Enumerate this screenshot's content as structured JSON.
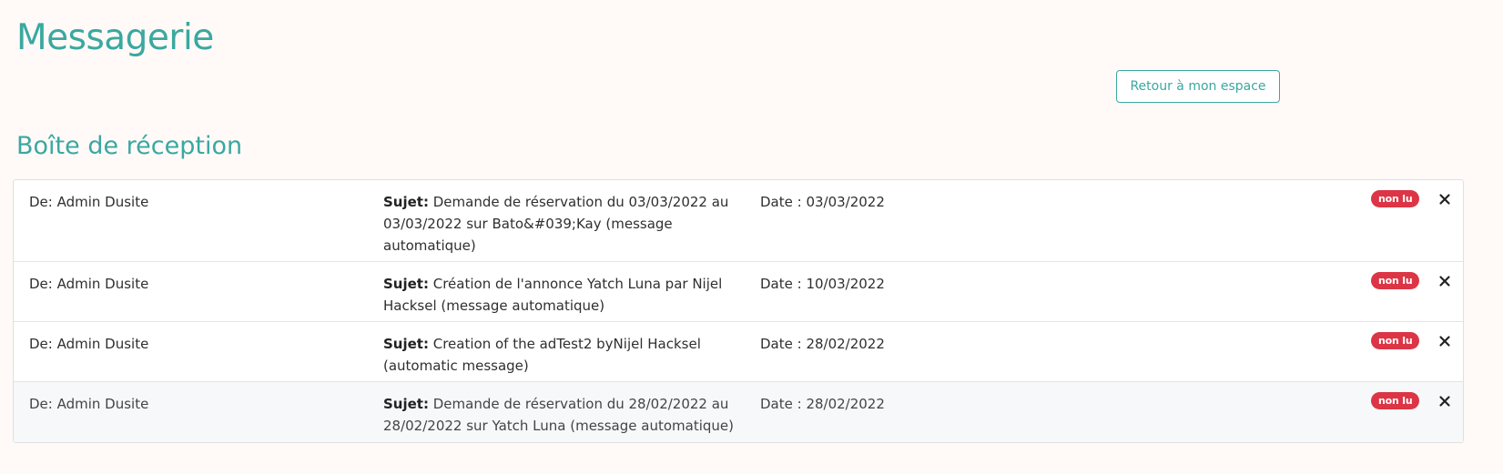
{
  "header": {
    "title": "Messagerie",
    "back_button_label": "Retour à mon espace"
  },
  "inbox": {
    "title": "Boîte de réception",
    "subject_prefix": "Sujet:",
    "unread_badge": "non lu",
    "delete_icon": "close-icon",
    "colors": {
      "accent": "#3aa8a0",
      "badge": "#dc3545"
    },
    "messages": [
      {
        "from": "De: Admin Dusite",
        "subject": "Demande de réservation du 03/03/2022 au 03/03/2022 sur Bato&#039;Kay (message automatique)",
        "date": "Date : 03/03/2022",
        "status": "non lu"
      },
      {
        "from": "De: Admin Dusite",
        "subject": "Création de l'annonce Yatch Luna par Nijel Hacksel (message automatique)",
        "date": "Date : 10/03/2022",
        "status": "non lu"
      },
      {
        "from": "De: Admin Dusite",
        "subject": "Creation of the adTest2 byNijel Hacksel (automatic message)",
        "date": "Date : 28/02/2022",
        "status": "non lu"
      },
      {
        "from": "De: Admin Dusite",
        "subject": "Demande de réservation du 28/02/2022 au 28/02/2022 sur Yatch Luna (message automatique)",
        "date": "Date : 28/02/2022",
        "status": "non lu"
      }
    ]
  }
}
